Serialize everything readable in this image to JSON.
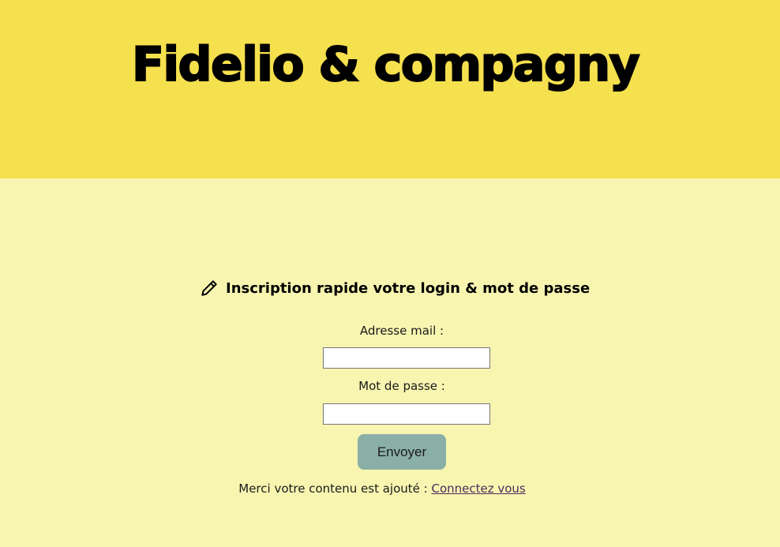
{
  "header": {
    "site_title": "Fidelio & compagny",
    "background_color": "#f5e04e"
  },
  "main": {
    "background_color": "#f8f5b1"
  },
  "form": {
    "heading_icon": "pencil-icon",
    "heading": "Inscription rapide votre login & mot de passe",
    "email_label": "Adresse mail :",
    "email_value": "",
    "password_label": "Mot de passe :",
    "password_value": "",
    "submit_label": "Envoyer",
    "submit_color": "#8aafa7"
  },
  "footer": {
    "message": "Merci votre contenu est ajouté : ",
    "link_label": "Connectez vous"
  }
}
